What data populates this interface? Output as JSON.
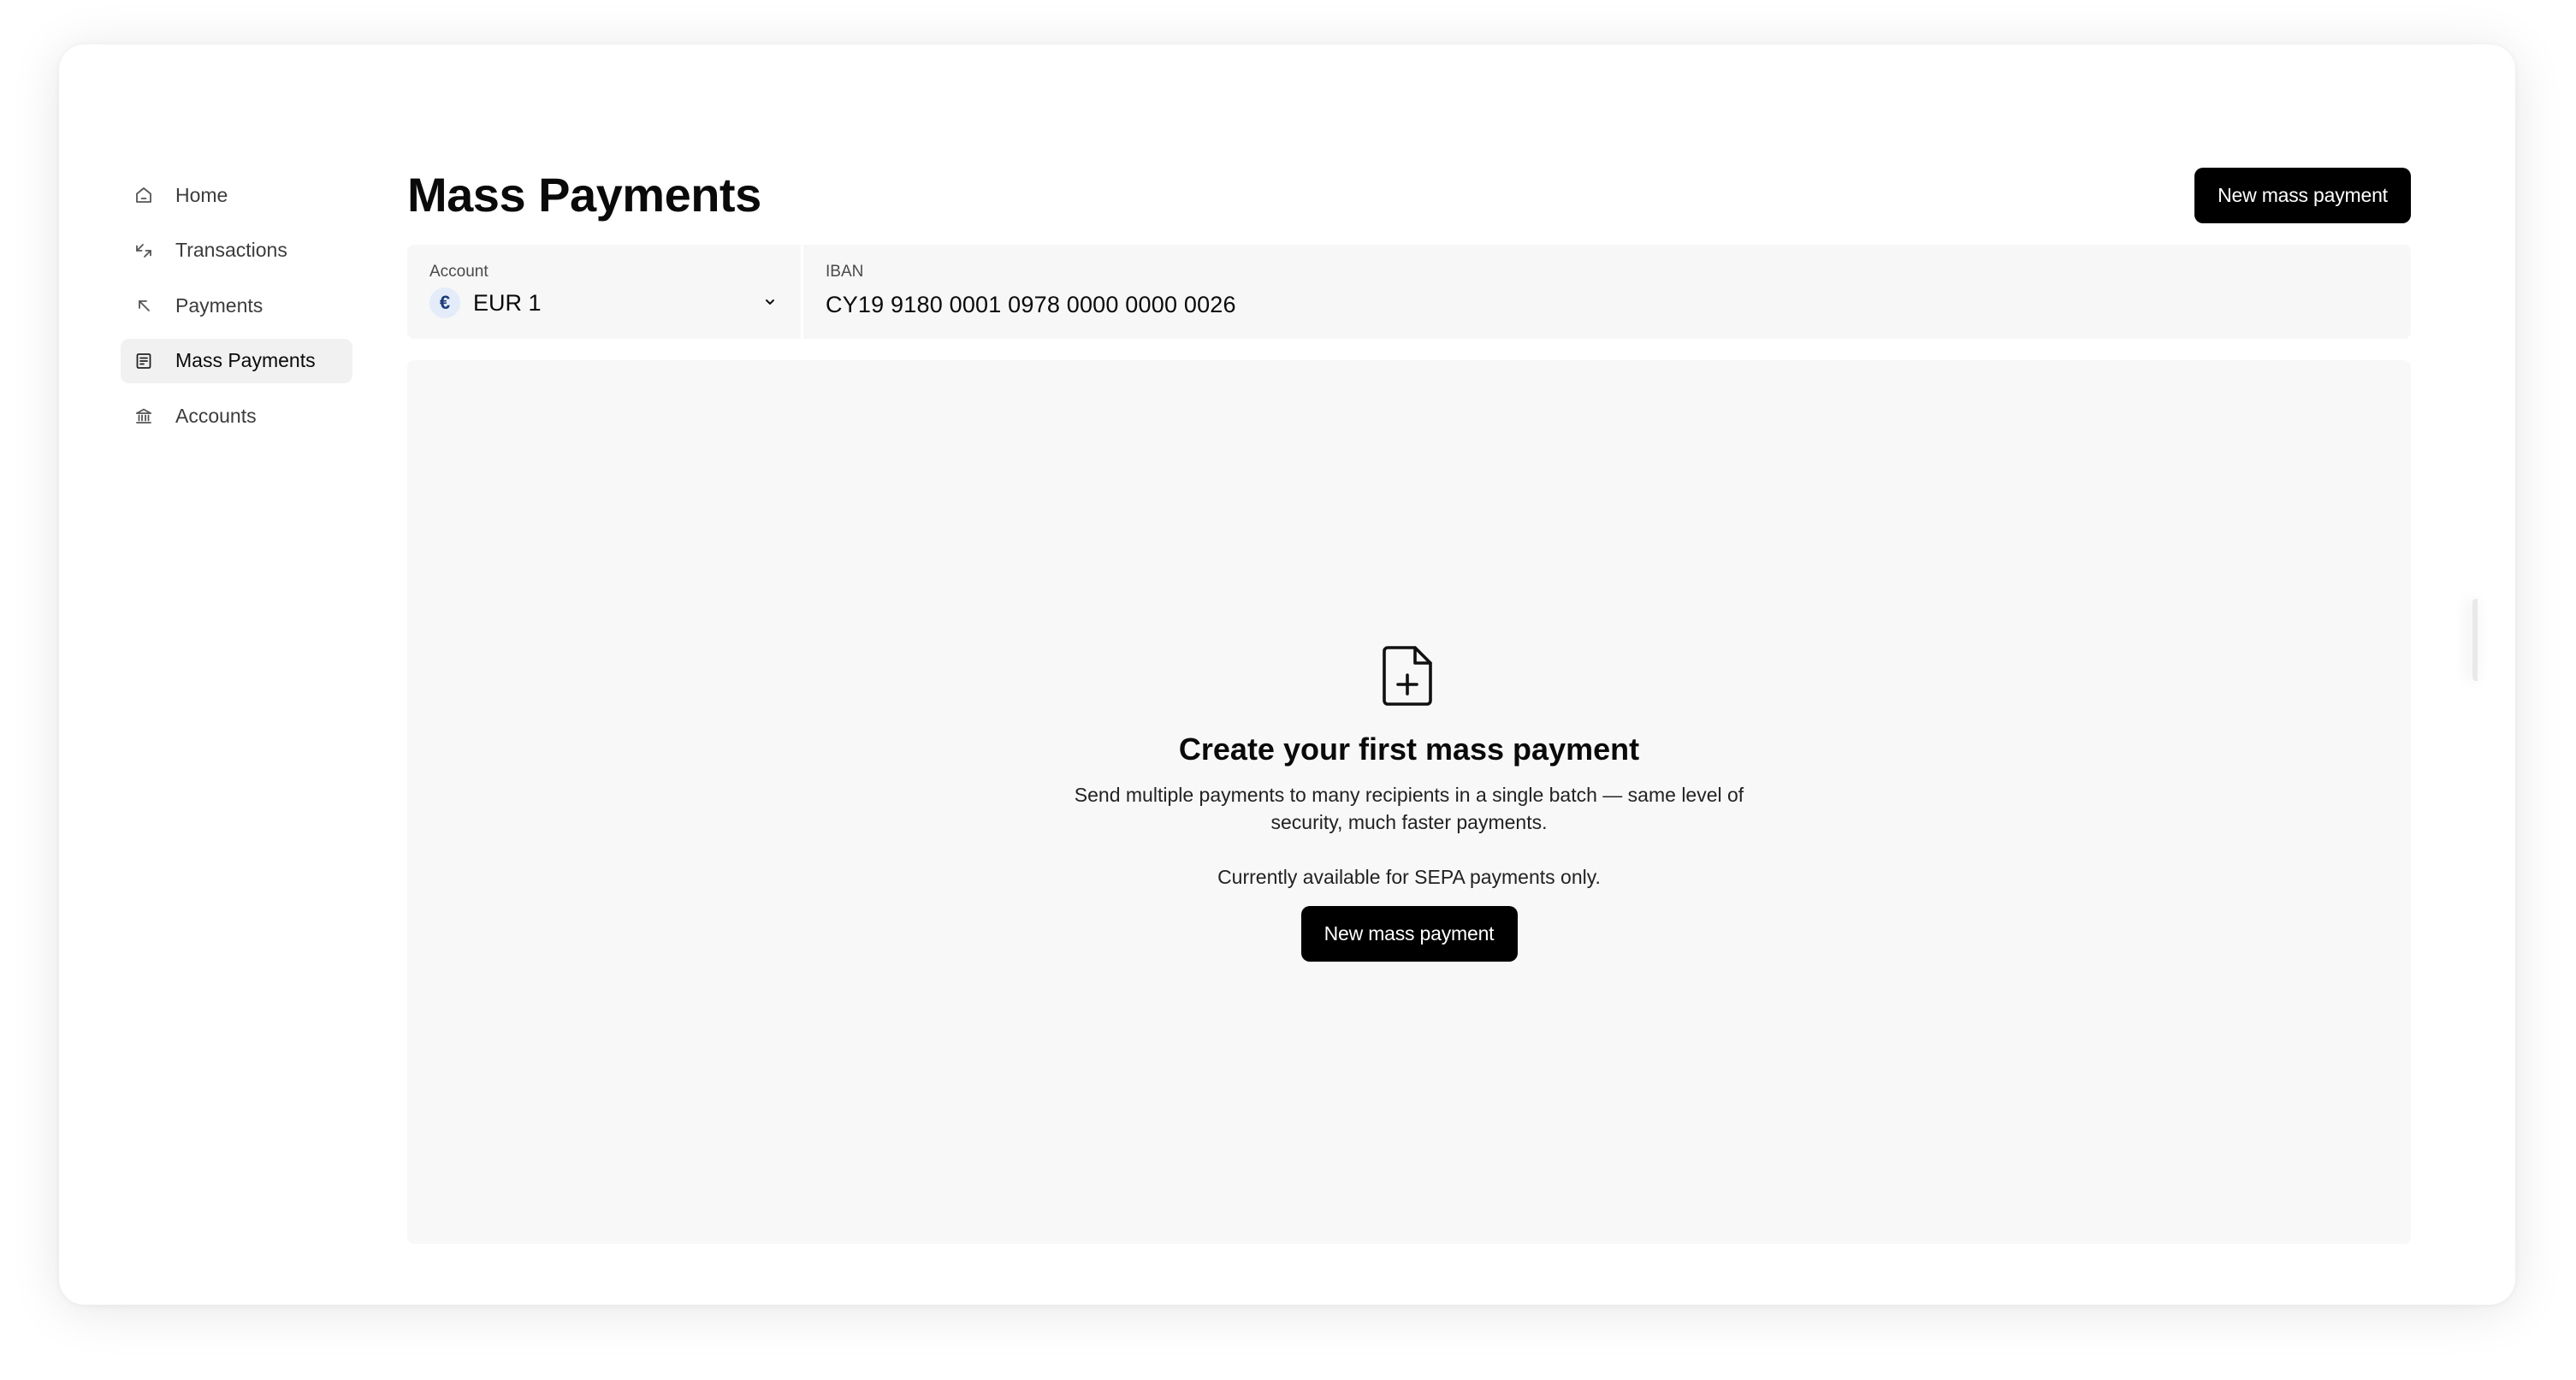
{
  "sidebar": {
    "items": [
      {
        "label": "Home",
        "icon": "home-icon",
        "active": false
      },
      {
        "label": "Transactions",
        "icon": "transactions-icon",
        "active": false
      },
      {
        "label": "Payments",
        "icon": "arrow-up-left-icon",
        "active": false
      },
      {
        "label": "Mass Payments",
        "icon": "mass-payments-icon",
        "active": true
      },
      {
        "label": "Accounts",
        "icon": "bank-icon",
        "active": false
      }
    ]
  },
  "header": {
    "title": "Mass Payments",
    "new_button_label": "New mass payment"
  },
  "account_bar": {
    "account_label": "Account",
    "currency_symbol": "€",
    "account_value": "EUR 1",
    "iban_label": "IBAN",
    "iban_value": "CY19 9180 0001 0978 0000 0000 0026"
  },
  "empty_state": {
    "icon": "file-plus-icon",
    "title": "Create your first mass payment",
    "description": "Send multiple payments to many recipients in a single batch — same level of security, much faster payments.",
    "note": "Currently available for SEPA payments only.",
    "button_label": "New mass payment"
  },
  "colors": {
    "primary_button": "#000000",
    "panel_background": "#f8f8f8",
    "active_nav_background": "#f1f1f1",
    "currency_badge": "#e3ecf8"
  }
}
